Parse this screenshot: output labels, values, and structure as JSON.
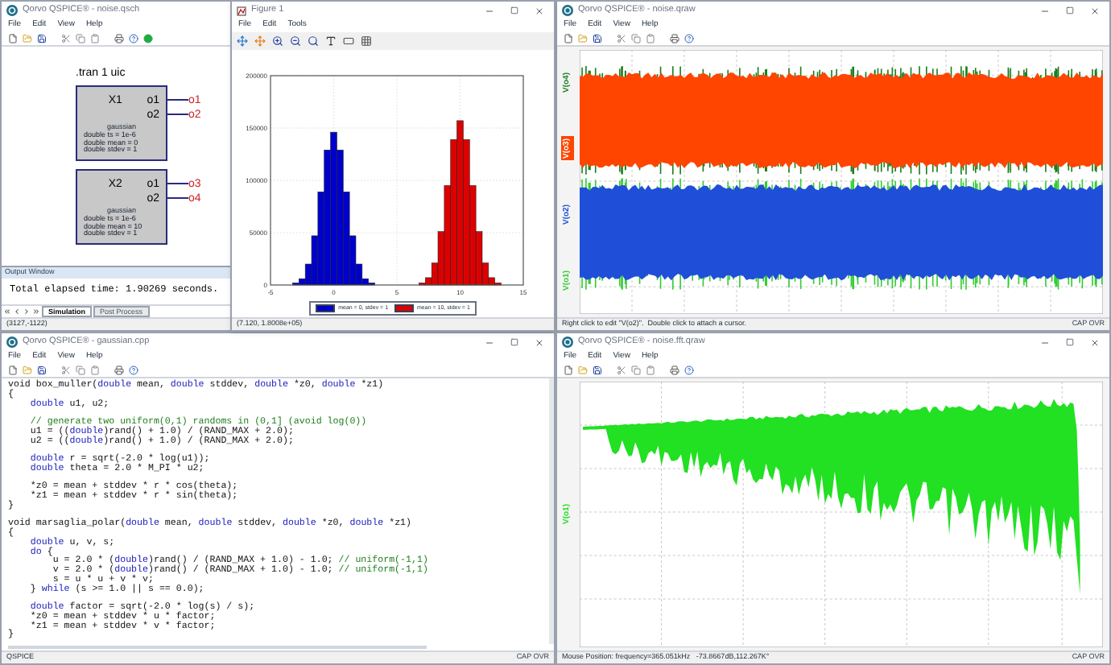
{
  "schematic_window": {
    "title": "Qorvo QSPICE® - noise.qsch",
    "menu": [
      "File",
      "Edit",
      "View",
      "Help"
    ],
    "directive": ".tran 1 uic",
    "blocks": [
      {
        "name": "X1",
        "model": "gaussian",
        "params": [
          "double ts = 1e-6",
          "double mean = 0",
          "double stdev = 1"
        ],
        "pins": [
          {
            "pin": "o1",
            "net": "o1"
          },
          {
            "pin": "o2",
            "net": "o2"
          }
        ]
      },
      {
        "name": "X2",
        "model": "gaussian",
        "params": [
          "double ts = 1e-6",
          "double mean = 10",
          "double stdev = 1"
        ],
        "pins": [
          {
            "pin": "o1",
            "net": "o3"
          },
          {
            "pin": "o2",
            "net": "o4"
          }
        ]
      }
    ],
    "output_window": {
      "title": "Output Window",
      "text": "Total elapsed time: 1.90269 seconds.",
      "tabs": [
        {
          "label": "Simulation",
          "selected": true
        },
        {
          "label": "Post Process",
          "selected": false
        }
      ]
    },
    "status": "(3127,-1122)"
  },
  "figure_window": {
    "title": "Figure 1",
    "menu": [
      "File",
      "Edit",
      "Tools"
    ],
    "chart_data": {
      "type": "bar",
      "x": [
        -3.5,
        -3,
        -2.5,
        -2,
        -1.5,
        -1,
        -0.5,
        0,
        0.5,
        1,
        1.5,
        2,
        2.5,
        3,
        3.5,
        6.5,
        7,
        7.5,
        8,
        8.5,
        9,
        9.5,
        10,
        10.5,
        11,
        11.5,
        12,
        12.5,
        13,
        13.5
      ],
      "series": [
        {
          "name": "mean = 0, stdev = 1",
          "color": "#0000cc",
          "values": [
            0,
            2000,
            6000,
            20000,
            47000,
            89000,
            129000,
            146000,
            129000,
            89000,
            47000,
            20000,
            6000,
            2000,
            0,
            null,
            null,
            null,
            null,
            null,
            null,
            null,
            null,
            null,
            null,
            null,
            null,
            null,
            null,
            null
          ]
        },
        {
          "name": "mean = 10, stdev = 1",
          "color": "#dd0000",
          "values": [
            null,
            null,
            null,
            null,
            null,
            null,
            null,
            null,
            null,
            null,
            null,
            null,
            null,
            null,
            null,
            0,
            2000,
            7000,
            21000,
            51000,
            95000,
            139000,
            157000,
            139000,
            95000,
            51000,
            21000,
            7000,
            2000,
            0
          ]
        }
      ],
      "grid": true,
      "xlim": [
        -5,
        15
      ],
      "ylim": [
        0,
        200000
      ],
      "xticks": [
        -5,
        0,
        5,
        10,
        15
      ],
      "yticks": [
        0,
        50000,
        100000,
        150000,
        200000
      ]
    },
    "status": "(7.120, 1.8008e+05)"
  },
  "waveform_window": {
    "title": "Qorvo QSPICE® - noise.qraw",
    "menu": [
      "File",
      "Edit",
      "View",
      "Help"
    ],
    "traces": [
      {
        "label": "V(o4)",
        "color": "#1e7d1e",
        "selected": false
      },
      {
        "label": "V(o3)",
        "color": "#ff4500",
        "selected": true
      },
      {
        "label": "V(o2)",
        "color": "#1f4fd8",
        "selected": false
      },
      {
        "label": "V(o1)",
        "color": "#33cc33",
        "selected": false
      }
    ],
    "status": "Right click to edit \"V(o2)\".  Double click to attach a cursor.",
    "indicator": "CAP OVR"
  },
  "code_window": {
    "title": "Qorvo QSPICE® - gaussian.cpp",
    "menu": [
      "File",
      "Edit",
      "View",
      "Help"
    ],
    "lines": [
      {
        "kind": "code",
        "segments": [
          {
            "text": "void box_muller(",
            "kind": "plain"
          },
          {
            "text": "double",
            "kind": "keyword"
          },
          {
            "text": " mean, ",
            "kind": "plain"
          },
          {
            "text": "double",
            "kind": "keyword"
          },
          {
            "text": " stddev, ",
            "kind": "plain"
          },
          {
            "text": "double",
            "kind": "keyword"
          },
          {
            "text": " *z0, ",
            "kind": "plain"
          },
          {
            "text": "double",
            "kind": "keyword"
          },
          {
            "text": " *z1)",
            "kind": "plain"
          }
        ]
      },
      {
        "kind": "code",
        "segments": [
          {
            "text": "{",
            "kind": "plain"
          }
        ]
      },
      {
        "kind": "code",
        "segments": [
          {
            "text": "    double",
            "kind": "keyword"
          },
          {
            "text": " u1, u2;",
            "kind": "plain"
          }
        ]
      },
      {
        "kind": "blank"
      },
      {
        "kind": "code",
        "segments": [
          {
            "text": "    // generate two uniform(0,1) randoms in (0,1] (avoid log(0))",
            "kind": "comment"
          }
        ]
      },
      {
        "kind": "code",
        "segments": [
          {
            "text": "    u1 = ((",
            "kind": "plain"
          },
          {
            "text": "double",
            "kind": "keyword"
          },
          {
            "text": ")rand() + 1.0) / (RAND_MAX + 2.0);",
            "kind": "plain"
          }
        ]
      },
      {
        "kind": "code",
        "segments": [
          {
            "text": "    u2 = ((",
            "kind": "plain"
          },
          {
            "text": "double",
            "kind": "keyword"
          },
          {
            "text": ")rand() + 1.0) / (RAND_MAX + 2.0);",
            "kind": "plain"
          }
        ]
      },
      {
        "kind": "blank"
      },
      {
        "kind": "code",
        "segments": [
          {
            "text": "    double",
            "kind": "keyword"
          },
          {
            "text": " r = sqrt(-2.0 * log(u1));",
            "kind": "plain"
          }
        ]
      },
      {
        "kind": "code",
        "segments": [
          {
            "text": "    double",
            "kind": "keyword"
          },
          {
            "text": " theta = 2.0 * M_PI * u2;",
            "kind": "plain"
          }
        ]
      },
      {
        "kind": "blank"
      },
      {
        "kind": "code",
        "segments": [
          {
            "text": "    *z0 = mean + stddev * r * cos(theta);",
            "kind": "plain"
          }
        ]
      },
      {
        "kind": "code",
        "segments": [
          {
            "text": "    *z1 = mean + stddev * r * sin(theta);",
            "kind": "plain"
          }
        ]
      },
      {
        "kind": "code",
        "segments": [
          {
            "text": "}",
            "kind": "plain"
          }
        ]
      },
      {
        "kind": "blank"
      },
      {
        "kind": "code",
        "segments": [
          {
            "text": "void marsaglia_polar(",
            "kind": "plain"
          },
          {
            "text": "double",
            "kind": "keyword"
          },
          {
            "text": " mean, ",
            "kind": "plain"
          },
          {
            "text": "double",
            "kind": "keyword"
          },
          {
            "text": " stddev, ",
            "kind": "plain"
          },
          {
            "text": "double",
            "kind": "keyword"
          },
          {
            "text": " *z0, ",
            "kind": "plain"
          },
          {
            "text": "double",
            "kind": "keyword"
          },
          {
            "text": " *z1)",
            "kind": "plain"
          }
        ]
      },
      {
        "kind": "code",
        "segments": [
          {
            "text": "{",
            "kind": "plain"
          }
        ]
      },
      {
        "kind": "code",
        "segments": [
          {
            "text": "    double",
            "kind": "keyword"
          },
          {
            "text": " u, v, s;",
            "kind": "plain"
          }
        ]
      },
      {
        "kind": "code",
        "segments": [
          {
            "text": "    do",
            "kind": "keyword"
          },
          {
            "text": " {",
            "kind": "plain"
          }
        ]
      },
      {
        "kind": "code",
        "segments": [
          {
            "text": "        u = 2.0 * (",
            "kind": "plain"
          },
          {
            "text": "double",
            "kind": "keyword"
          },
          {
            "text": ")rand() / (RAND_MAX + 1.0) - 1.0; ",
            "kind": "plain"
          },
          {
            "text": "// uniform(-1,1)",
            "kind": "comment"
          }
        ]
      },
      {
        "kind": "code",
        "segments": [
          {
            "text": "        v = 2.0 * (",
            "kind": "plain"
          },
          {
            "text": "double",
            "kind": "keyword"
          },
          {
            "text": ")rand() / (RAND_MAX + 1.0) - 1.0; ",
            "kind": "plain"
          },
          {
            "text": "// uniform(-1,1)",
            "kind": "comment"
          }
        ]
      },
      {
        "kind": "code",
        "segments": [
          {
            "text": "        s = u * u + v * v;",
            "kind": "plain"
          }
        ]
      },
      {
        "kind": "code",
        "segments": [
          {
            "text": "    } ",
            "kind": "plain"
          },
          {
            "text": "while",
            "kind": "keyword"
          },
          {
            "text": " (s >= 1.0 || s == 0.0);",
            "kind": "plain"
          }
        ]
      },
      {
        "kind": "blank"
      },
      {
        "kind": "code",
        "segments": [
          {
            "text": "    double",
            "kind": "keyword"
          },
          {
            "text": " factor = sqrt(-2.0 * log(s) / s);",
            "kind": "plain"
          }
        ]
      },
      {
        "kind": "code",
        "segments": [
          {
            "text": "    *z0 = mean + stddev * u * factor;",
            "kind": "plain"
          }
        ]
      },
      {
        "kind": "code",
        "segments": [
          {
            "text": "    *z1 = mean + stddev * v * factor;",
            "kind": "plain"
          }
        ]
      },
      {
        "kind": "code",
        "segments": [
          {
            "text": "}",
            "kind": "plain"
          }
        ]
      }
    ],
    "status": "QSPICE",
    "indicator": "CAP OVR"
  },
  "spectrum_window": {
    "title": "Qorvo QSPICE® - noise.fft.qraw",
    "menu": [
      "File",
      "Edit",
      "View",
      "Help"
    ],
    "trace": {
      "label": "V(o1)",
      "color": "#22e022"
    },
    "status": "Mouse Position: frequency=365.051kHz   -73.8667dB,112.267K°",
    "indicator": "CAP OVR"
  }
}
